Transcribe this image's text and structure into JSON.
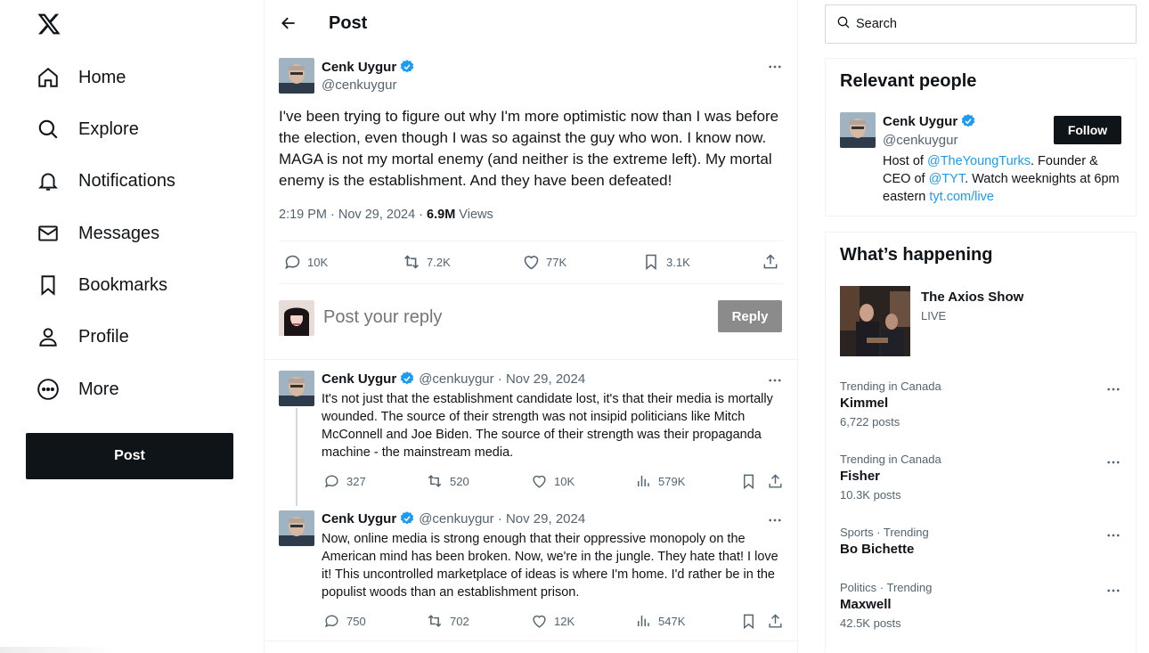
{
  "nav": {
    "items": [
      {
        "label": "Home",
        "icon": "home-icon"
      },
      {
        "label": "Explore",
        "icon": "search-icon"
      },
      {
        "label": "Notifications",
        "icon": "bell-icon"
      },
      {
        "label": "Messages",
        "icon": "envelope-icon"
      },
      {
        "label": "Bookmarks",
        "icon": "bookmark-icon"
      },
      {
        "label": "Profile",
        "icon": "person-icon"
      },
      {
        "label": "More",
        "icon": "more-circle-icon"
      }
    ],
    "post_label": "Post"
  },
  "header": {
    "title": "Post"
  },
  "main_post": {
    "name": "Cenk Uygur",
    "handle": "@cenkuygur",
    "text": "I've been trying to figure out why I'm more optimistic now than I was before the election, even though I was so against the guy who won. I know now. MAGA is not my mortal enemy (and neither is the extreme left). My mortal enemy is the establishment. And they have been defeated!",
    "time": "2:19 PM · Nov 29, 2024 · ",
    "views_count": "6.9M",
    "views_label": " Views",
    "replies": "10K",
    "reposts": "7.2K",
    "likes": "77K",
    "bookmarks": "3.1K"
  },
  "reply_box": {
    "placeholder": "Post your reply",
    "button": "Reply"
  },
  "replies": [
    {
      "name": "Cenk Uygur",
      "handle": "@cenkuygur · Nov 29, 2024",
      "text": "It's not just that the establishment candidate lost, it's that their media is mortally wounded. The source of their strength was not insipid politicians like Mitch McConnell and Joe Biden. The source of their strength was their propaganda machine - the mainstream media.",
      "replies": "327",
      "reposts": "520",
      "likes": "10K",
      "views": "579K"
    },
    {
      "name": "Cenk Uygur",
      "handle": "@cenkuygur · Nov 29, 2024",
      "text": "Now, online media is strong enough that their oppressive monopoly on the American mind has been broken. Now, we're in the jungle. They hate that! I love it! This uncontrolled marketplace of ideas is where I'm home. I'd rather be in the populist woods than an establishment prison.",
      "replies": "750",
      "reposts": "702",
      "likes": "12K",
      "views": "547K"
    }
  ],
  "search": {
    "placeholder": "Search"
  },
  "relevant": {
    "title": "Relevant people",
    "name": "Cenk Uygur",
    "handle": "@cenkuygur",
    "follow": "Follow",
    "bio_1": "Host of ",
    "bio_link_1": "@TheYoungTurks",
    "bio_2": ". Founder & CEO of ",
    "bio_link_2": "@TYT",
    "bio_3": ". Watch weeknights at 6pm eastern ",
    "bio_link_3": "tyt.com/live"
  },
  "happening": {
    "title": "What’s happening",
    "feature_title": "The Axios Show",
    "feature_status": "LIVE",
    "trends": [
      {
        "context": "Trending in Canada",
        "name": "Kimmel",
        "count": "6,722 posts"
      },
      {
        "context": "Trending in Canada",
        "name": "Fisher",
        "count": "10.3K posts"
      },
      {
        "context": "Sports · Trending",
        "name": "Bo Bichette",
        "count": ""
      },
      {
        "context": "Politics · Trending",
        "name": "Maxwell",
        "count": "42.5K posts"
      }
    ]
  },
  "colors": {
    "accent": "#1d9bf0",
    "text": "#0f1419",
    "muted": "#536471",
    "button_dark": "#0f1419"
  }
}
